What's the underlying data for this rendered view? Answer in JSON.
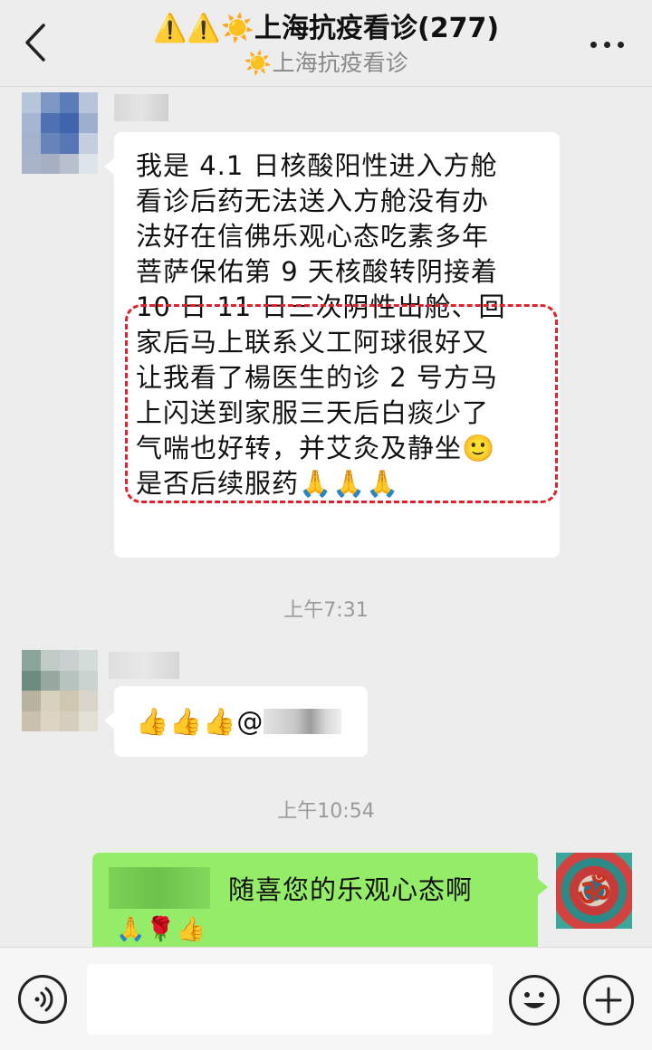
{
  "header": {
    "title_emojis": "⚠️⚠️☀️",
    "title": "上海抗疫看诊(277)",
    "subtitle_emoji": "☀️",
    "subtitle": "上海抗疫看诊"
  },
  "messages": [
    {
      "side": "left",
      "lines": [
        "我是 4.1 日核酸阳性进入方舱",
        "看诊后药无法送入方舱没有办",
        "法好在信佛乐观心态吃素多年",
        "菩萨保佑第 9 天核酸转阴接着",
        "10 日 11 日三次阴性出舱、回",
        "家后马上联系义工阿球很好又",
        "让我看了楊医生的诊 2 号方马",
        "上闪送到家服三天后白痰少了",
        "气喘也好转，并艾灸及静坐🙂",
        "是否后续服药🙏🙏🙏"
      ]
    },
    {
      "side": "left",
      "text": "👍👍👍@"
    },
    {
      "side": "right",
      "text": "随喜您的乐观心态啊",
      "line2": "🙏🌹👍"
    }
  ],
  "timestamps": [
    "上午7:31",
    "上午10:54"
  ],
  "self_avatar_glyph": "ॐ",
  "colors": {
    "background": "#ededed",
    "bubble_mine": "#95ec69",
    "bubble_other": "#ffffff",
    "highlight": "#e0202a"
  },
  "icons": [
    "back-arrow",
    "more-dots",
    "voice",
    "emoji",
    "plus"
  ]
}
